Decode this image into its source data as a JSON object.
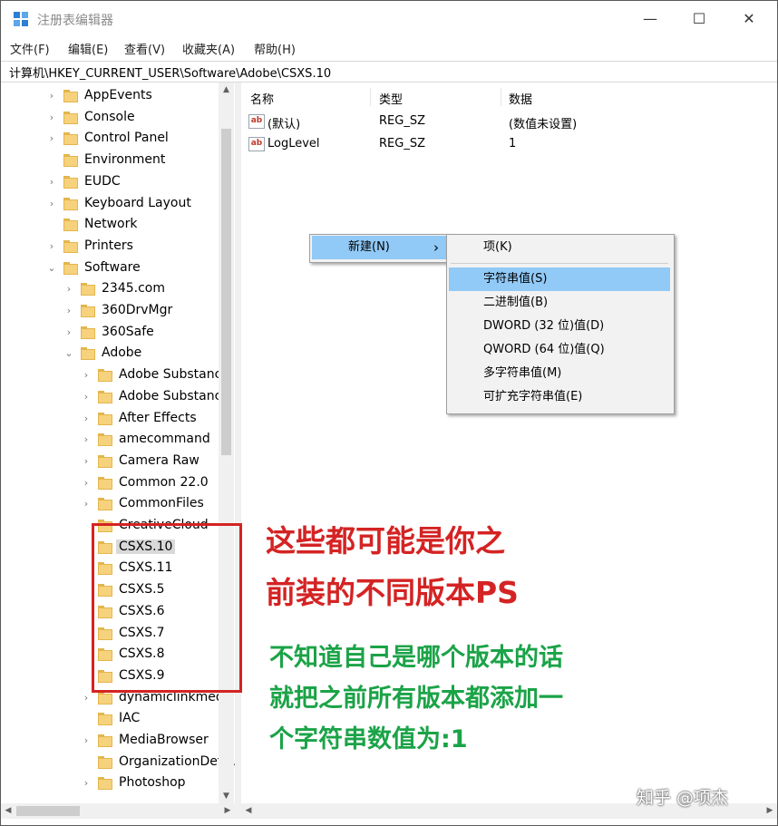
{
  "window": {
    "title": "注册表编辑器",
    "minimize": "—",
    "maximize": "☐",
    "close": "✕"
  },
  "menu": [
    "文件(F)",
    "编辑(E)",
    "查看(V)",
    "收藏夹(A)",
    "帮助(H)"
  ],
  "address": "计算机\\HKEY_CURRENT_USER\\Software\\Adobe\\CSXS.10",
  "tree": [
    {
      "label": "AppEvents",
      "level": 0,
      "expander": "collapsed"
    },
    {
      "label": "Console",
      "level": 0,
      "expander": "collapsed"
    },
    {
      "label": "Control Panel",
      "level": 0,
      "expander": "collapsed"
    },
    {
      "label": "Environment",
      "level": 0,
      "expander": "none"
    },
    {
      "label": "EUDC",
      "level": 0,
      "expander": "collapsed"
    },
    {
      "label": "Keyboard Layout",
      "level": 0,
      "expander": "collapsed"
    },
    {
      "label": "Network",
      "level": 0,
      "expander": "none"
    },
    {
      "label": "Printers",
      "level": 0,
      "expander": "collapsed"
    },
    {
      "label": "Software",
      "level": 0,
      "expander": "expanded"
    },
    {
      "label": "2345.com",
      "level": 1,
      "expander": "collapsed"
    },
    {
      "label": "360DrvMgr",
      "level": 1,
      "expander": "collapsed"
    },
    {
      "label": "360Safe",
      "level": 1,
      "expander": "collapsed"
    },
    {
      "label": "Adobe",
      "level": 1,
      "expander": "expanded"
    },
    {
      "label": "Adobe Substance",
      "level": 2,
      "expander": "collapsed"
    },
    {
      "label": "Adobe Substance",
      "level": 2,
      "expander": "collapsed"
    },
    {
      "label": "After Effects",
      "level": 2,
      "expander": "collapsed"
    },
    {
      "label": "amecommand",
      "level": 2,
      "expander": "collapsed"
    },
    {
      "label": "Camera Raw",
      "level": 2,
      "expander": "collapsed"
    },
    {
      "label": "Common 22.0",
      "level": 2,
      "expander": "collapsed"
    },
    {
      "label": "CommonFiles",
      "level": 2,
      "expander": "collapsed"
    },
    {
      "label": "CreativeCloud",
      "level": 2,
      "expander": "none"
    },
    {
      "label": "CSXS.10",
      "level": 2,
      "expander": "none",
      "selected": true
    },
    {
      "label": "CSXS.11",
      "level": 2,
      "expander": "none"
    },
    {
      "label": "CSXS.5",
      "level": 2,
      "expander": "none"
    },
    {
      "label": "CSXS.6",
      "level": 2,
      "expander": "none"
    },
    {
      "label": "CSXS.7",
      "level": 2,
      "expander": "none"
    },
    {
      "label": "CSXS.8",
      "level": 2,
      "expander": "none"
    },
    {
      "label": "CSXS.9",
      "level": 2,
      "expander": "none"
    },
    {
      "label": "dynamiclinkmediaserver",
      "level": 2,
      "expander": "collapsed"
    },
    {
      "label": "IAC",
      "level": 2,
      "expander": "none"
    },
    {
      "label": "MediaBrowser",
      "level": 2,
      "expander": "collapsed"
    },
    {
      "label": "OrganizationDefaults",
      "level": 2,
      "expander": "none"
    },
    {
      "label": "Photoshop",
      "level": 2,
      "expander": "collapsed"
    }
  ],
  "list": {
    "headers": {
      "name": "名称",
      "type": "类型",
      "data": "数据"
    },
    "rows": [
      {
        "icon": "ab",
        "name": "(默认)",
        "type": "REG_SZ",
        "data": "(数值未设置)"
      },
      {
        "icon": "ab",
        "name": "LogLevel",
        "type": "REG_SZ",
        "data": "1"
      }
    ]
  },
  "context_menu": {
    "new_label": "新建(N)",
    "submenu_arrow": "›",
    "items": [
      "项(K)",
      "字符串值(S)",
      "二进制值(B)",
      "DWORD (32 位)值(D)",
      "QWORD (64 位)值(Q)",
      "多字符串值(M)",
      "可扩充字符串值(E)"
    ],
    "highlighted_index": 1
  },
  "annotations": {
    "red_line1": "这些都可能是你之",
    "red_line2": "前装的不同版本PS",
    "green_line1": "不知道自己是哪个版本的话",
    "green_line2": "就把之前所有版本都添加一",
    "green_line3": "个字符串数值为:1",
    "red_color": "#d42323",
    "green_color": "#1ba347"
  },
  "watermark": "知乎 @项杰"
}
